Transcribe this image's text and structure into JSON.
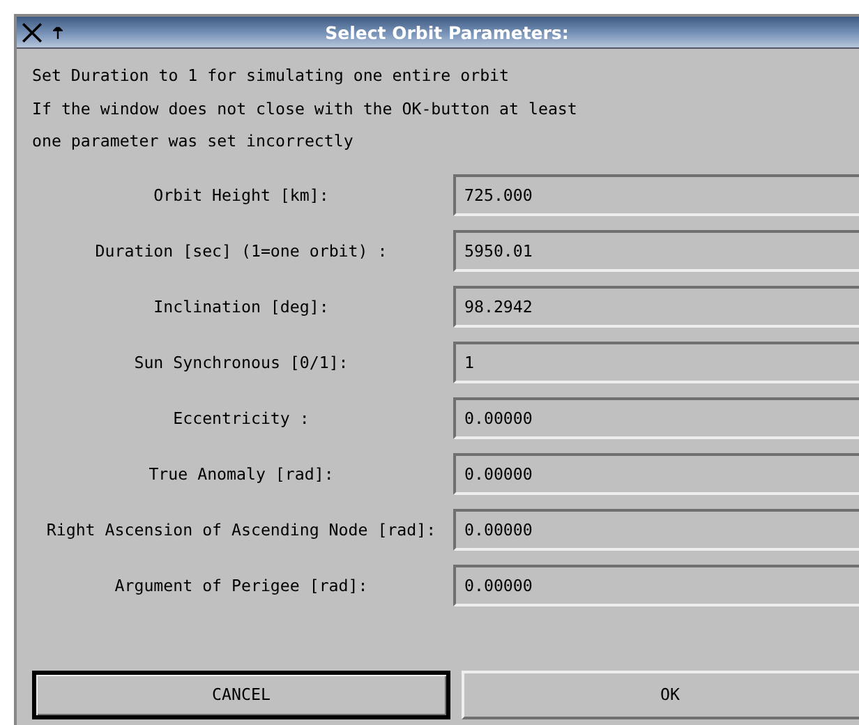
{
  "window": {
    "title": "Select Orbit Parameters:"
  },
  "instructions": [
    "Set Duration to 1 for simulating one entire orbit",
    "If the window does not close with the OK-button at least",
    "one parameter was set incorrectly"
  ],
  "parameters": [
    {
      "label": "Orbit Height [km]:",
      "value": "725.000"
    },
    {
      "label": "Duration [sec] (1=one orbit) :",
      "value": "5950.01"
    },
    {
      "label": "Inclination [deg]:",
      "value": "98.2942"
    },
    {
      "label": "Sun Synchronous [0/1]:",
      "value": "1"
    },
    {
      "label": "Eccentricity :",
      "value": "0.00000"
    },
    {
      "label": "True Anomaly [rad]:",
      "value": "0.00000"
    },
    {
      "label": "Right Ascension of Ascending Node [rad]:",
      "value": "0.00000"
    },
    {
      "label": "Argument of Perigee [rad]:",
      "value": "0.00000"
    }
  ],
  "buttons": [
    {
      "label": "CANCEL",
      "default": true
    },
    {
      "label": "OK",
      "default": false
    }
  ]
}
